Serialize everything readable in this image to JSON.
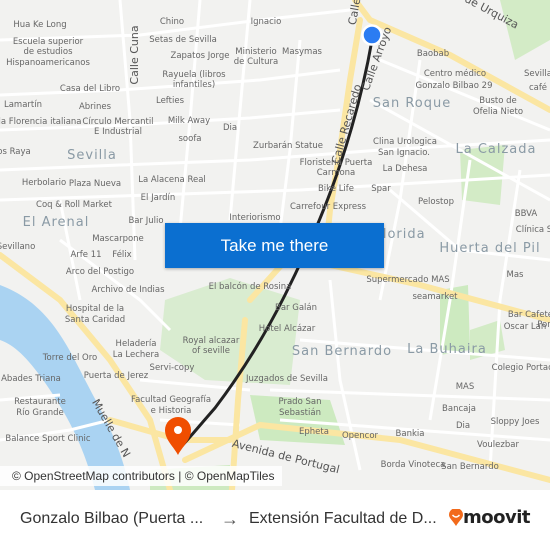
{
  "map": {
    "labels": [
      "Hua Ke Long",
      "Escuela superior",
      "de estudios",
      "Hispanoamericanos",
      "Chino",
      "Setas de Sevilla",
      "Zapatos Jorge",
      "Ignacio",
      "Ministerio",
      "de Cultura",
      "Masymas",
      "Rayuela (libros",
      "infantiles)",
      "Casa del Libro",
      "Lamartín",
      "Abrines",
      "Lefties",
      "la Florencia italiana",
      "Círculo Mercantil",
      "E Industrial",
      "Milk Away",
      "Dia",
      "soofa",
      "os Raya",
      "Zurbarán Statue",
      "Herbolario",
      "Plaza Nueva",
      "La Alacena Real",
      "El Jardín",
      "Coq & Roll Market",
      "Bar Julio",
      "Interiorismo",
      "Mascarpone",
      "Arfe 11",
      "Félix",
      "Sevillano",
      "Arco del Postigo",
      "Archivo de Indias",
      "El balcón de Rosina",
      "Hospital de la",
      "Santa Caridad",
      "Bar Galán",
      "Hotel Alcázar",
      "Royal alcazar",
      "of seville",
      "Heladería",
      "La Lechera",
      "Torre del Oro",
      "Servi-copy",
      "Abades Triana",
      "Puerta de Jerez",
      "Juzgados de Sevilla",
      "Restaurante",
      "Río Grande",
      "Facultad Geografía",
      "e Historia",
      "Prado San",
      "Sebastián",
      "Balance Sport Clinic",
      "Epheta",
      "Opencor",
      "Bankia",
      "Borda Vinoteca",
      "San Bernardo",
      "Baobab",
      "Centro médico",
      "Gonzalo Bilbao 29",
      "Busto de",
      "Ofelia Nieto",
      "Sevilla",
      "café",
      "Clina Urologica",
      "San Ignacio.",
      "Floristería Puerta",
      "Carmona",
      "La Dehesa",
      "Bike Life",
      "Spar",
      "Carrefour Express",
      "Pelostop",
      "BBVA",
      "Clínica S",
      "Supermercado MAS",
      "Mas",
      "seamarket",
      "Bar Cafetería",
      "Oscar Lan",
      "Por",
      "Colegio Portacel",
      "MAS",
      "Bancaja",
      "Dia",
      "Sloppy Joes",
      "Voulezbar"
    ],
    "areas": [
      "Sevilla",
      "El Arenal",
      "San Roque",
      "La Calzada",
      "Florida",
      "Huerta del Pil",
      "San Bernardo",
      "La Buhaira"
    ],
    "streets": [
      "Calle Cuna",
      "Calle Recaredo",
      "Calle Arroyo",
      "Calle",
      "de Urquiza",
      "Avenida de Portugal",
      "Muelle de N"
    ],
    "colors": {
      "route": "#222222",
      "origin": "#2b7cf2",
      "destination": "#f04e00",
      "button": "#0b6fd0",
      "major_road": "#fbe6a2",
      "water": "#aad3f2",
      "park": "#cdeac0"
    },
    "origin_icon": "blue-location-dot-icon",
    "destination_icon": "orange-map-pin-icon"
  },
  "cta": {
    "label": "Take me there"
  },
  "attribution": "© OpenStreetMap contributors | © OpenMapTiles",
  "trip": {
    "from": "Gonzalo Bilbao (Puerta ...",
    "arrow": "→",
    "to": "Extensión Facultad de D...",
    "brand": "moovit"
  }
}
